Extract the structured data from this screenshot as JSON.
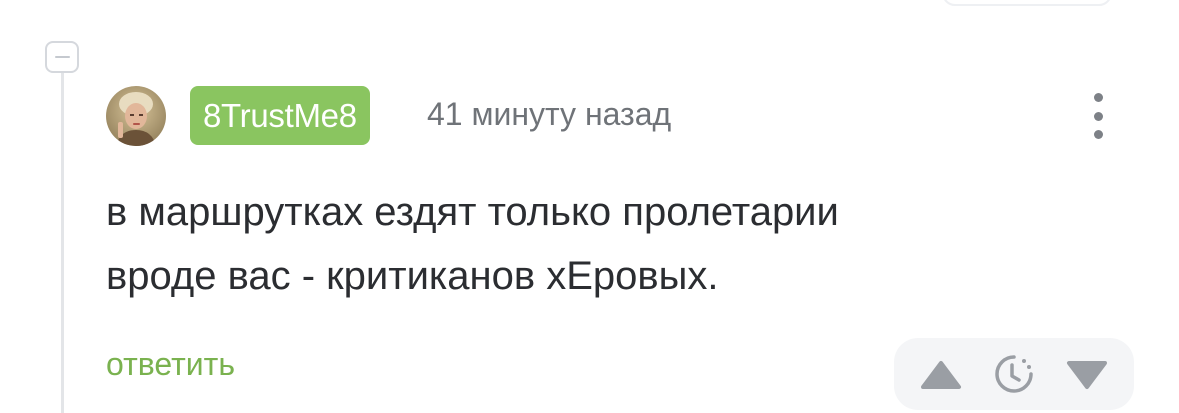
{
  "comment": {
    "author": "8TrustMe8",
    "timestamp": "41 минуту назад",
    "text_lines": [
      "в маршрутках ездят только пролетарии",
      "вроде вас - критиканов хЕровых."
    ],
    "reply_label": "ответить"
  },
  "icons": {
    "collapse": "minus-icon",
    "more": "more-vertical-icon",
    "vote_up": "triangle-up-icon",
    "rating_pending": "clock-icon",
    "vote_down": "triangle-down-icon"
  },
  "colors": {
    "author_badge": "#8ac560",
    "reply_link": "#7ab24f",
    "comment_text": "#2b2d31",
    "muted_text": "#6f7378",
    "vote_panel_bg": "#f4f5f7"
  }
}
